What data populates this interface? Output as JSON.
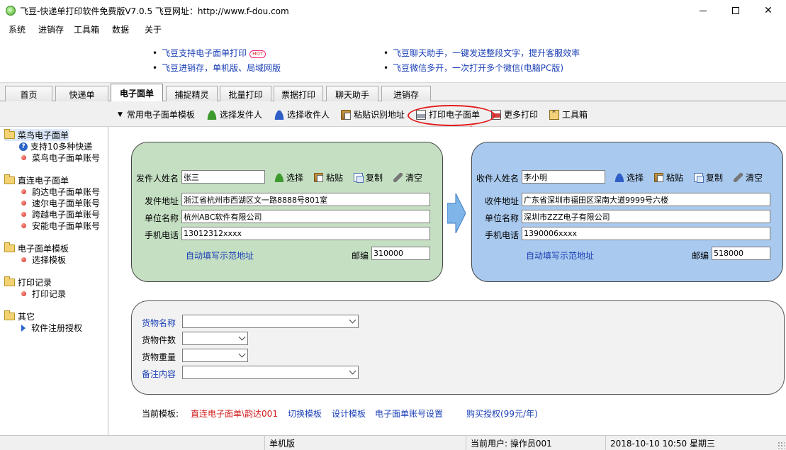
{
  "window": {
    "title": "飞豆-快递单打印软件免费版V7.0.5  飞豆网址：http://www.f-dou.com"
  },
  "menu": [
    "系统",
    "进销存",
    "工具箱",
    "数据",
    "关于"
  ],
  "ads": {
    "left": [
      "飞豆支持电子面单打印",
      "飞豆进销存，单机版、局域网版"
    ],
    "hot_badge": "HOT",
    "right": [
      "飞豆聊天助手，一键发送整段文字，提升客服效率",
      "飞豆微信多开，一次打开多个微信(电脑PC版)"
    ]
  },
  "tabs": [
    "首页",
    "快递单",
    "电子面单",
    "捕捉精灵",
    "批量打印",
    "票据打印",
    "聊天助手",
    "进销存"
  ],
  "active_tab": "电子面单",
  "toolbar": {
    "template_menu": "常用电子面单模板",
    "select_sender": "选择发件人",
    "select_receiver": "选择收件人",
    "paste_address": "粘贴识别地址",
    "print_waybill": "打印电子面单",
    "more_print": "更多打印",
    "toolbox": "工具箱"
  },
  "sidebar": {
    "groups": [
      {
        "label": "菜鸟电子面单",
        "items": [
          "支持10多种快递",
          "菜鸟电子面单账号"
        ]
      },
      {
        "label": "直连电子面单",
        "items": [
          "韵达电子面单账号",
          "速尔电子面单账号",
          "跨越电子面单账号",
          "安能电子面单账号"
        ]
      },
      {
        "label": "电子面单模板",
        "items": [
          "选择模板"
        ]
      },
      {
        "label": "打印记录",
        "items": [
          "打印记录"
        ]
      },
      {
        "label": "其它",
        "items": [
          "软件注册授权"
        ]
      }
    ]
  },
  "sender": {
    "name_label": "发件人姓名",
    "name": "张三",
    "select": "选择",
    "paste": "粘贴",
    "copy": "复制",
    "clear": "清空",
    "address_label": "发件地址",
    "address": "浙江省杭州市西湖区文一路8888号801室",
    "company_label": "单位名称",
    "company": "杭州ABC软件有限公司",
    "phone_label": "手机电话",
    "phone": "13012312xxxx",
    "autofill": "自动填写示范地址",
    "zip_label": "邮编",
    "zip": "310000"
  },
  "receiver": {
    "name_label": "收件人姓名",
    "name": "李小明",
    "select": "选择",
    "paste": "粘贴",
    "copy": "复制",
    "clear": "清空",
    "address_label": "收件地址",
    "address": "广东省深圳市福田区深南大道9999号六楼",
    "company_label": "单位名称",
    "company": "深圳市ZZZ电子有限公司",
    "phone_label": "手机电话",
    "phone": "1390006xxxx",
    "autofill": "自动填写示范地址",
    "zip_label": "邮编",
    "zip": "518000"
  },
  "goods": {
    "name_label": "货物名称",
    "count_label": "货物件数",
    "weight_label": "货物重量",
    "remark_label": "备注内容"
  },
  "footer": {
    "current_template_label": "当前模板:",
    "current_template": "直连电子面单\\韵达001",
    "switch_template": "切换模板",
    "design_template": "设计模板",
    "account_settings": "电子面单账号设置",
    "buy_license": "购买授权(99元/年)"
  },
  "status": {
    "mode": "单机版",
    "user": "当前用户: 操作员001",
    "datetime": "2018-10-10  10:50  星期三"
  },
  "colors": {
    "sender_panel": "#c5dfc3",
    "receiver_panel": "#a9c9ee",
    "link": "#1a3fb5",
    "highlight": "#e51c1c"
  }
}
